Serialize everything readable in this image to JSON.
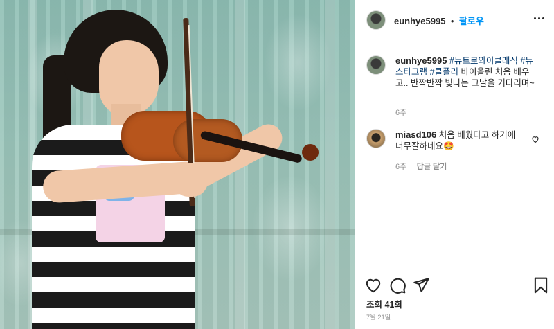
{
  "post": {
    "author": "eunhye5995",
    "follow_label": "팔로우",
    "separator": "•"
  },
  "caption": {
    "author": "eunhye5995",
    "hashtags": [
      "#뉴트로와이클래식",
      "#뉴스타그램",
      "#클플리"
    ],
    "text": "바이올린 처음 배우고.. 반짝반짝 빛나는 그날을 기다리며~",
    "time": "6주"
  },
  "comments": [
    {
      "author": "miasd106",
      "text": "처음 배웠다고 하기에 너무잘하네요🤩",
      "time": "6주",
      "reply_label": "답글 달기"
    }
  ],
  "actions": {
    "views": "조회 41회",
    "date": "7월 21일"
  },
  "icons": {
    "more": "more-options-icon",
    "like": "heart-icon",
    "comment": "comment-bubble-icon",
    "share": "paper-plane-icon",
    "save": "bookmark-icon",
    "comment_like": "small-heart-icon"
  }
}
